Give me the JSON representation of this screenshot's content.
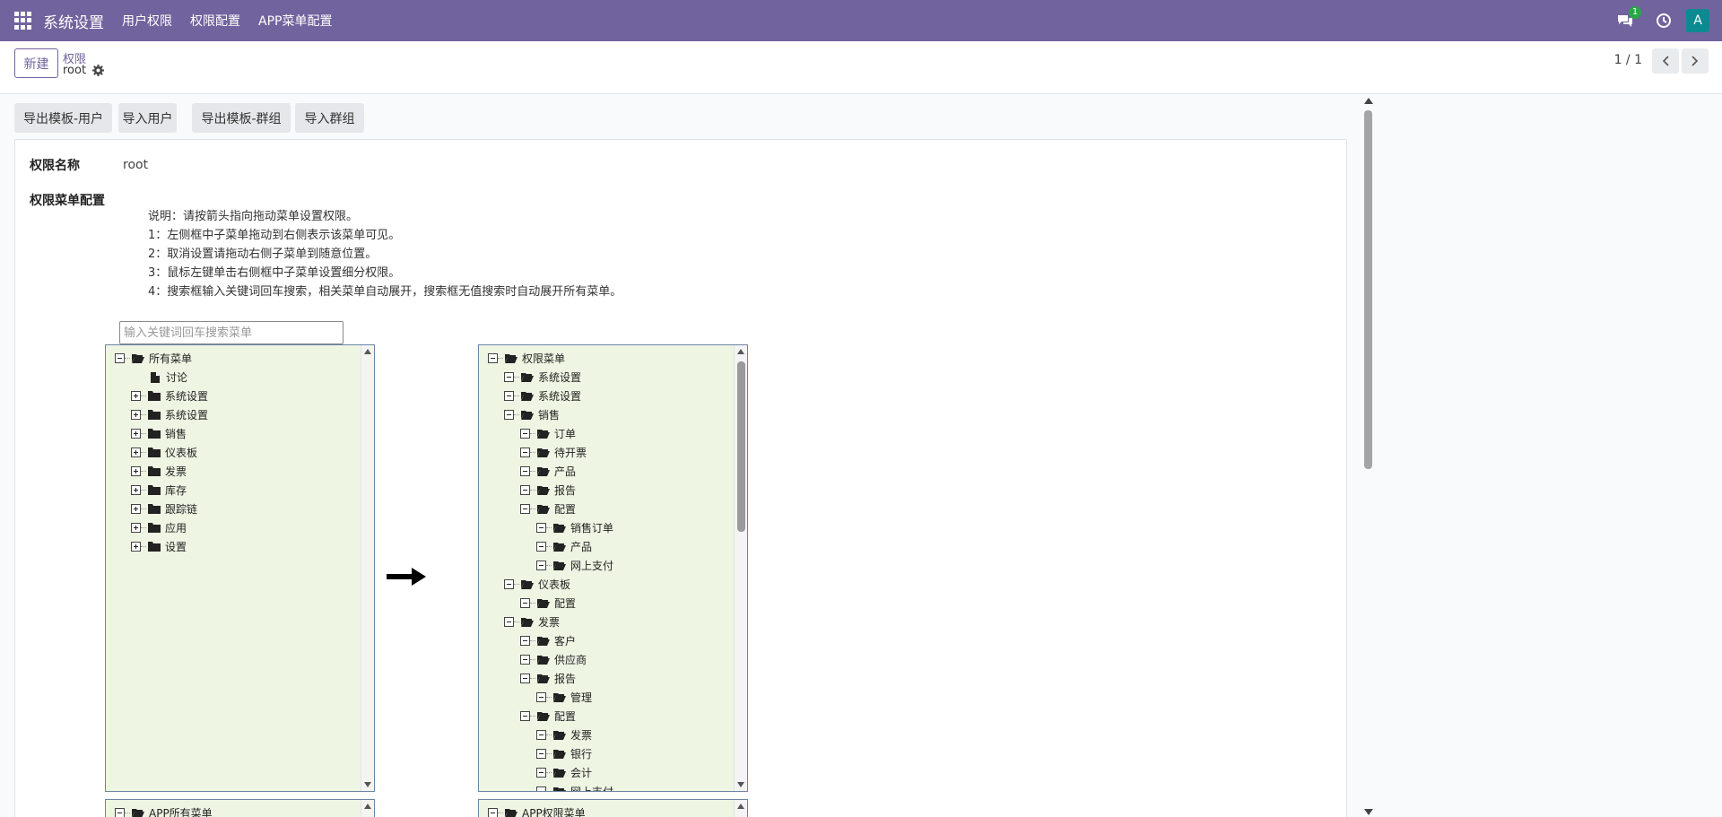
{
  "navbar": {
    "app_title": "系统设置",
    "menus": [
      "用户权限",
      "权限配置",
      "APP菜单配置"
    ],
    "chat_badge": "1",
    "avatar_letter": "A"
  },
  "control_panel": {
    "new_button": "新建",
    "breadcrumb": "权限",
    "record_name": "root",
    "pager": "1 / 1"
  },
  "actions": [
    "导出模板-用户",
    "导入用户",
    "导出模板-群组",
    "导入群组"
  ],
  "form": {
    "name_label": "权限名称",
    "name_value": "root",
    "menu_config_label": "权限菜单配置",
    "help_lines": [
      "说明：请按箭头指向拖动菜单设置权限。",
      "1：左侧框中子菜单拖动到右侧表示该菜单可见。",
      "2：取消设置请拖动右侧子菜单到随意位置。",
      "3：鼠标左键单击右侧框中子菜单设置细分权限。",
      "4：搜索框输入关键词回车搜索，相关菜单自动展开，搜索框无值搜索时自动展开所有菜单。"
    ],
    "search_placeholder": "输入关键词回车搜索菜单"
  },
  "left_tree": {
    "root": "所有菜单",
    "items": [
      "讨论",
      "系统设置",
      "系统设置",
      "销售",
      "仪表板",
      "发票",
      "库存",
      "跟踪链",
      "应用",
      "设置"
    ]
  },
  "right_tree": {
    "root": "权限菜单",
    "items": [
      "系统设置",
      "系统设置",
      "销售",
      "订单",
      "待开票",
      "产品",
      "报告",
      "配置",
      "销售订单",
      "产品",
      "网上支付",
      "仪表板",
      "配置",
      "发票",
      "客户",
      "供应商",
      "报告",
      "管理",
      "配置",
      "发票",
      "银行",
      "会计",
      "网上支付"
    ]
  },
  "bottom_left_tree": {
    "root": "APP所有菜单"
  },
  "bottom_right_tree": {
    "root": "APP权限菜单"
  },
  "colors": {
    "navbar": "#71639e",
    "tree_bg": "#eef5e3",
    "badge": "#28a745",
    "avatar": "#0c8a91"
  }
}
